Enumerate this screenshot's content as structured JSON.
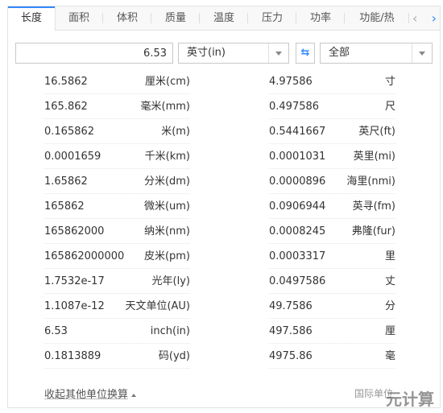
{
  "tabs": [
    "长度",
    "面积",
    "体积",
    "质量",
    "温度",
    "压力",
    "功率",
    "功能/热"
  ],
  "controls": {
    "value": "6.53",
    "from_unit": "英寸(in)",
    "to_unit": "全部",
    "swap_symbol": "⇆"
  },
  "left_results": [
    {
      "value": "16.5862",
      "unit": "厘米(cm)"
    },
    {
      "value": "165.862",
      "unit": "毫米(mm)"
    },
    {
      "value": "0.165862",
      "unit": "米(m)"
    },
    {
      "value": "0.0001659",
      "unit": "千米(km)"
    },
    {
      "value": "1.65862",
      "unit": "分米(dm)"
    },
    {
      "value": "165862",
      "unit": "微米(um)"
    },
    {
      "value": "165862000",
      "unit": "纳米(nm)"
    },
    {
      "value": "165862000000",
      "unit": "皮米(pm)"
    },
    {
      "value": "1.7532e-17",
      "unit": "光年(ly)"
    },
    {
      "value": "1.1087e-12",
      "unit": "天文单位(AU)"
    },
    {
      "value": "6.53",
      "unit": "inch(in)"
    },
    {
      "value": "0.1813889",
      "unit": "码(yd)"
    }
  ],
  "right_results": [
    {
      "value": "4.97586",
      "unit": "寸"
    },
    {
      "value": "0.497586",
      "unit": "尺"
    },
    {
      "value": "0.5441667",
      "unit": "英尺(ft)"
    },
    {
      "value": "0.0001031",
      "unit": "英里(mi)"
    },
    {
      "value": "0.0000896",
      "unit": "海里(nmi)"
    },
    {
      "value": "0.0906944",
      "unit": "英寻(fm)"
    },
    {
      "value": "0.0008245",
      "unit": "弗隆(fur)"
    },
    {
      "value": "0.0003317",
      "unit": "里"
    },
    {
      "value": "0.0497586",
      "unit": "丈"
    },
    {
      "value": "49.7586",
      "unit": "分"
    },
    {
      "value": "497.586",
      "unit": "厘"
    },
    {
      "value": "4975.86",
      "unit": "毫"
    }
  ],
  "footer": {
    "collapse_label": "收起其他单位换算",
    "right_text": "国际单位"
  },
  "watermark": "元计算",
  "accent_color": "#3388ff"
}
